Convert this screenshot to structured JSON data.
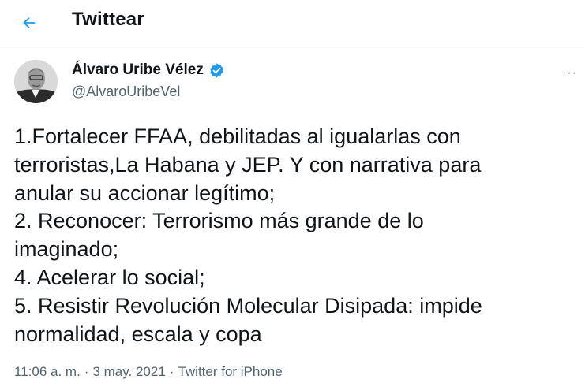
{
  "header": {
    "back_icon": "arrow-left-icon",
    "title": "Twittear"
  },
  "author": {
    "name": "Álvaro Uribe Vélez",
    "handle": "@AlvaroUribeVel",
    "verified_icon": "verified-badge-icon",
    "avatar_icon": "avatar"
  },
  "more_menu": {
    "icon": "more-icon",
    "label": "···"
  },
  "tweet": {
    "text": "1.Fortalecer FFAA, debilitadas al igualarlas con\nterroristas,La Habana y JEP. Y con narrativa para\nanular su accionar legítimo;\n2. Reconocer: Terrorismo más grande de lo\nimaginado;\n4. Acelerar lo social;\n5. Resistir Revolución Molecular Disipada: impide\nnormalidad, escala y copa"
  },
  "meta": {
    "time": "11:06 a. m.",
    "separator": "·",
    "date": "3 may. 2021",
    "source": "Twitter for iPhone"
  },
  "colors": {
    "accent": "#1d9bf0",
    "text": "#0f1419",
    "secondary": "#536471"
  }
}
